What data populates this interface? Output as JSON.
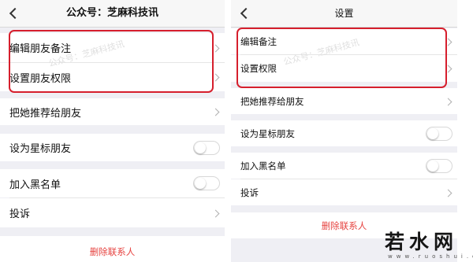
{
  "left_screen": {
    "title": "公众号：芝麻科技讯",
    "items": [
      {
        "label": "编辑朋友备注"
      },
      {
        "label": "设置朋友权限"
      },
      {
        "label": "把她推荐给朋友"
      },
      {
        "label": "设为星标朋友"
      },
      {
        "label": "加入黑名单"
      },
      {
        "label": "投诉"
      }
    ],
    "delete_label": "删除联系人",
    "watermark": "公众号：芝麻科技讯"
  },
  "right_screen": {
    "title": "设置",
    "items": [
      {
        "label": "编辑备注"
      },
      {
        "label": "设置权限"
      },
      {
        "label": "把她推荐给朋友"
      },
      {
        "label": "设为星标朋友"
      },
      {
        "label": "加入黑名单"
      },
      {
        "label": "投诉"
      }
    ],
    "delete_label": "删除联系人",
    "watermark": "公众号：芝麻科技讯"
  },
  "toggles": {
    "star_friend": false,
    "blacklist": false
  },
  "logo": {
    "text": "若水网",
    "sub": "www.ruoshui.com"
  },
  "colors": {
    "highlight": "#d61f2d",
    "delete_text": "#e64340",
    "background": "#efeff4"
  }
}
